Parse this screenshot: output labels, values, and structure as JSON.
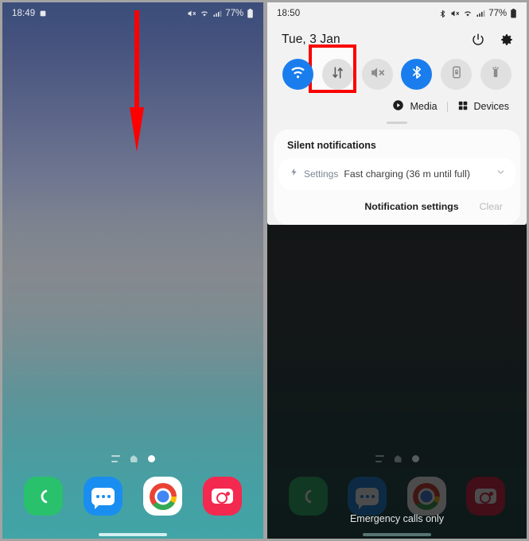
{
  "left_screen": {
    "status_bar": {
      "time": "18:49",
      "left_icons": [
        "alarm-icon"
      ],
      "right_icons": [
        "mute-icon",
        "wifi-icon",
        "signal-icon"
      ],
      "battery_percent": "77%"
    },
    "page_indicators": [
      "apps-lines-indicator",
      "home-page-indicator",
      "current-page-dot"
    ],
    "dock": [
      {
        "name": "Phone",
        "icon": "phone-icon",
        "color": "#29c16c"
      },
      {
        "name": "Messages",
        "icon": "messages-icon",
        "color": "#1a8ef0"
      },
      {
        "name": "Chrome",
        "icon": "chrome-icon",
        "color": "#ffffff"
      },
      {
        "name": "Camera",
        "icon": "camera-icon",
        "color": "#f4294f"
      }
    ]
  },
  "annotation": {
    "arrow": {
      "direction": "down",
      "color": "#fe0000"
    },
    "highlight_box": {
      "target": "mobile-data-tile",
      "color": "#fb0000"
    }
  },
  "right_screen": {
    "status_bar": {
      "time": "18:50",
      "right_icons": [
        "bluetooth-icon",
        "mute-icon",
        "wifi-icon",
        "signal-icon"
      ],
      "battery_percent": "77%"
    },
    "quick_panel": {
      "date": "Tue, 3 Jan",
      "header_buttons": [
        {
          "label": "Power",
          "icon": "power-icon"
        },
        {
          "label": "Settings",
          "icon": "gear-icon"
        }
      ],
      "tiles": [
        {
          "label": "Wi-Fi",
          "icon": "wifi-icon",
          "state": "on"
        },
        {
          "label": "Mobile data",
          "icon": "mobile-data-icon",
          "state": "off"
        },
        {
          "label": "Mute",
          "icon": "mute-icon",
          "state": "off"
        },
        {
          "label": "Bluetooth",
          "icon": "bluetooth-icon",
          "state": "on"
        },
        {
          "label": "Auto rotate",
          "icon": "rotate-lock-icon",
          "state": "off"
        },
        {
          "label": "Flashlight",
          "icon": "flashlight-icon",
          "state": "off"
        }
      ],
      "media_label": "Media",
      "media_icon": "play-circle-icon",
      "devices_label": "Devices",
      "devices_icon": "devices-grid-icon"
    },
    "notifications": {
      "section_title": "Silent notifications",
      "items": [
        {
          "icon": "charging-bolt-icon",
          "app": "Settings",
          "text": "Fast charging (36 m until full)",
          "expand_icon": "chevron-down-icon"
        }
      ],
      "settings_label": "Notification settings",
      "clear_label": "Clear"
    },
    "page_indicators": [
      "apps-lines-indicator",
      "home-page-indicator",
      "current-page-dot"
    ],
    "dock": [
      {
        "name": "Phone",
        "icon": "phone-icon"
      },
      {
        "name": "Messages",
        "icon": "messages-icon"
      },
      {
        "name": "Chrome",
        "icon": "chrome-icon"
      },
      {
        "name": "Camera",
        "icon": "camera-icon"
      }
    ],
    "emergency_text": "Emergency calls only"
  },
  "colors": {
    "accent_blue": "#1a7ded",
    "annotation_red": "#fb0000",
    "panel_bg": "#f2f2f2",
    "card_bg": "#fbfbfb"
  }
}
